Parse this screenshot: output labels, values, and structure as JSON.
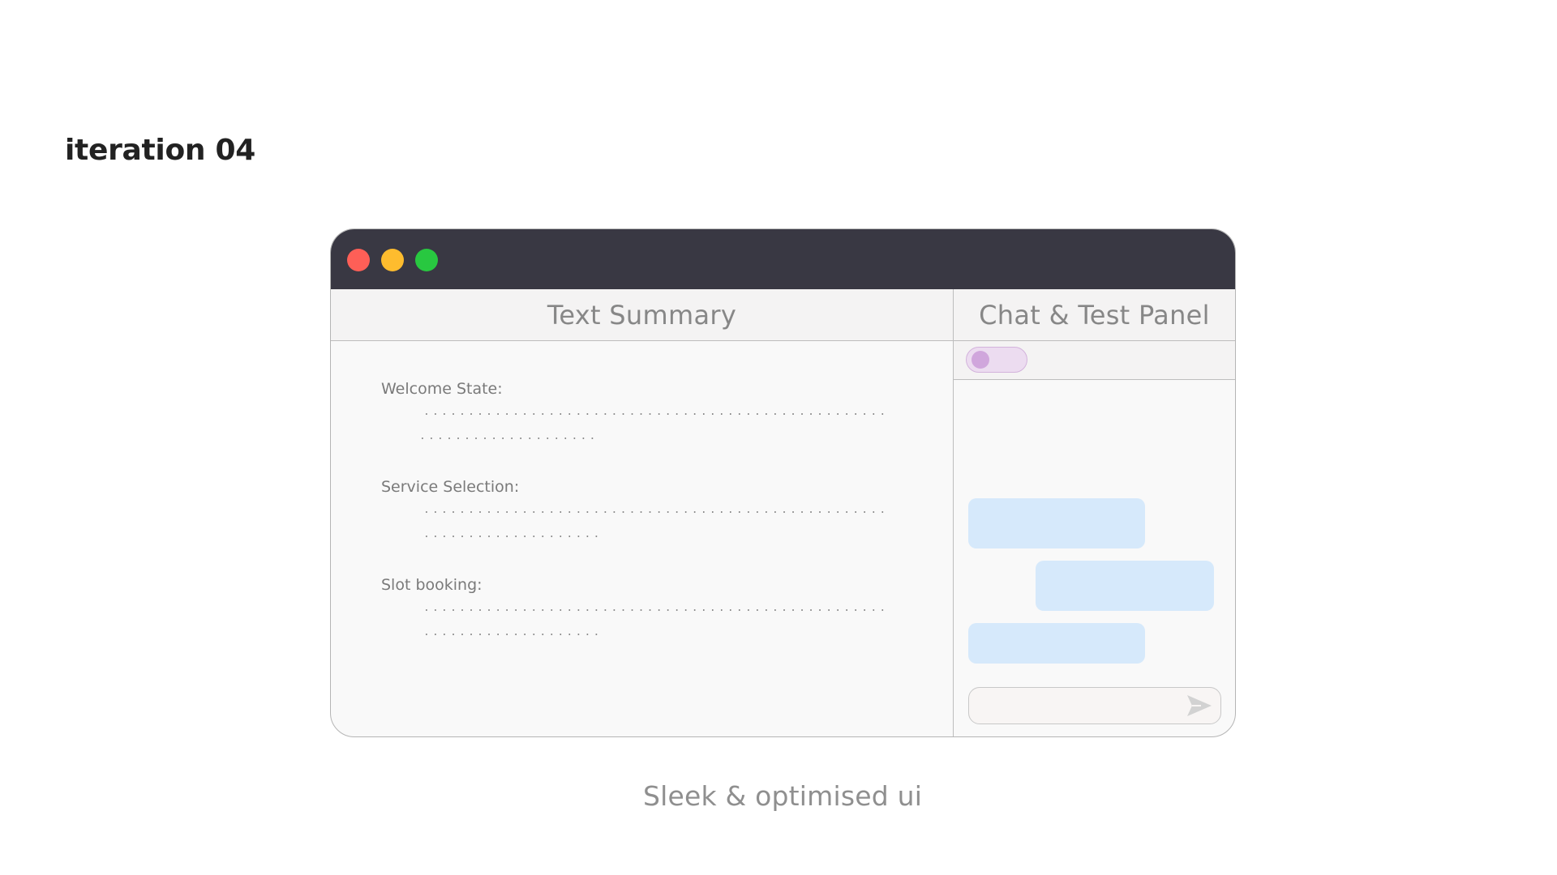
{
  "page": {
    "heading": "iteration 04",
    "caption": "Sleek & optimised ui"
  },
  "window": {
    "controls": [
      {
        "name": "close",
        "color": "#fe5f57"
      },
      {
        "name": "minimize",
        "color": "#febc2e"
      },
      {
        "name": "maximize",
        "color": "#28c840"
      }
    ],
    "titlebar_color": "#393843"
  },
  "summary_panel": {
    "title": "Text Summary",
    "sections": [
      {
        "label": "Welcome State:",
        "line1": "...............................................................",
        "line2": "........................"
      },
      {
        "label": "Service Selection:",
        "line1": "...............................................................",
        "line2": "........................"
      },
      {
        "label": "Slot booking:",
        "line1": "...............................................................",
        "line2": "........................"
      }
    ]
  },
  "chat_panel": {
    "title": "Chat & Test Panel",
    "toggle": {
      "state": "off",
      "color": "#d0a6dc"
    },
    "bubble_color": "#d6e9fb",
    "messages": [
      {
        "side": "left"
      },
      {
        "side": "right"
      },
      {
        "side": "left"
      }
    ],
    "input": {
      "value": "",
      "placeholder": ""
    },
    "send_icon": "send-arrow-icon"
  }
}
